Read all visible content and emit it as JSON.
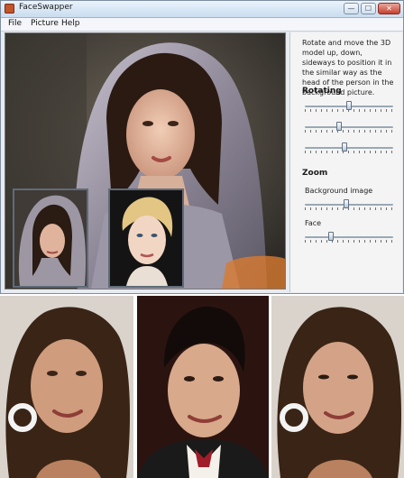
{
  "window": {
    "title": "FaceSwapper",
    "min_icon": "minimize-icon",
    "max_icon": "maximize-icon",
    "close_icon": "close-icon",
    "min_glyph": "—",
    "max_glyph": "☐",
    "close_glyph": "✕"
  },
  "menu": {
    "file": "File",
    "picture": "Picture",
    "help": "Help"
  },
  "panel": {
    "description": "Rotate and move the 3D model up, down, sideways to position it in the similar way as the head of the person in the background picture.",
    "rotating_label": "Rotating",
    "zoom_label": "Zoom",
    "background_image_label": "Background image",
    "face_label": "Face",
    "rotate_sliders": [
      0.5,
      0.38,
      0.45
    ],
    "zoom_background_value": 0.47,
    "zoom_face_value": 0.28
  },
  "colors": {
    "accent": "#c4552a",
    "window_bg": "#e7ecf2"
  }
}
